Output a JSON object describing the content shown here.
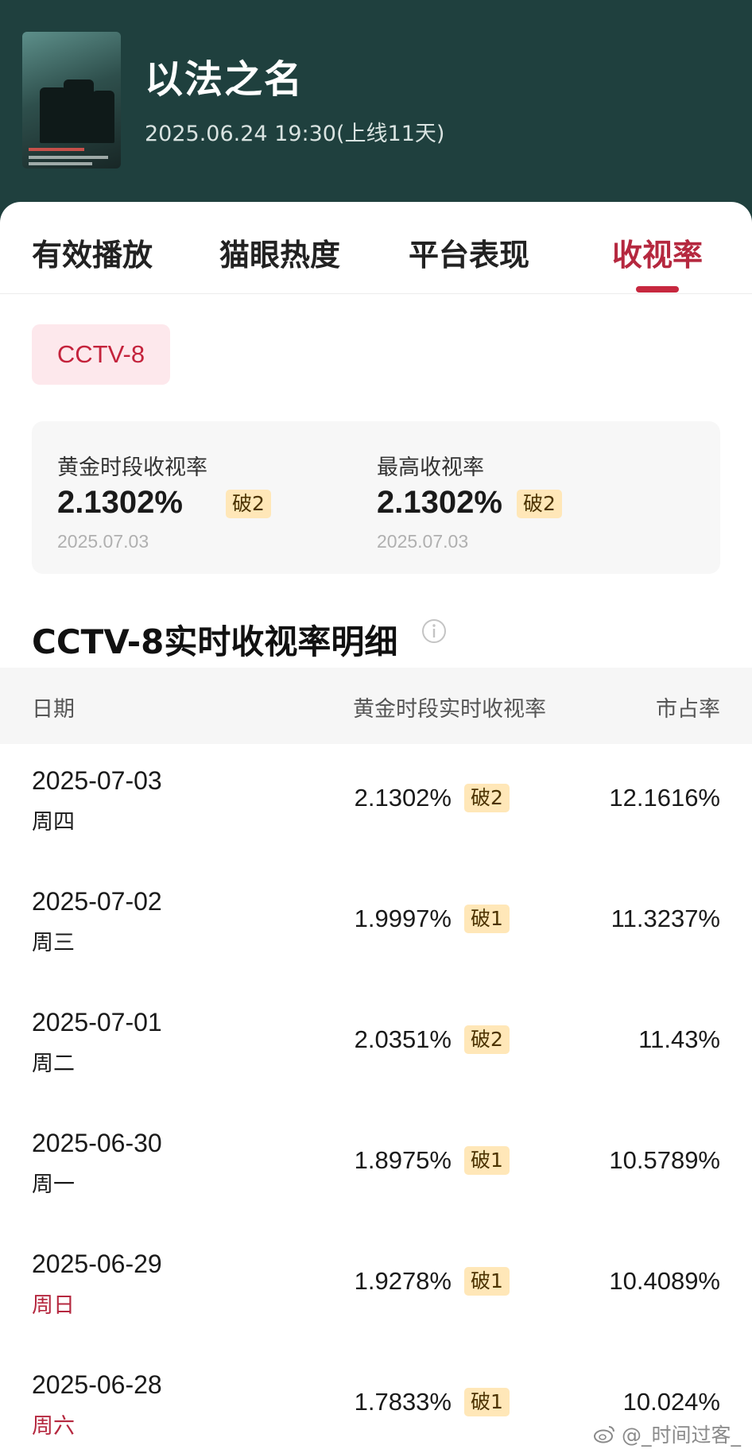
{
  "header": {
    "title": "以法之名",
    "subtitle": "2025.06.24 19:30(上线11天)"
  },
  "tabs": [
    {
      "label": "有效播放"
    },
    {
      "label": "猫眼热度"
    },
    {
      "label": "平台表现"
    },
    {
      "label": "收视率"
    }
  ],
  "active_tab_index": 3,
  "channel_chip": "CCTV-8",
  "stats": {
    "prime": {
      "label": "黄金时段收视率",
      "value": "2.1302%",
      "badge": "破2",
      "date": "2025.07.03"
    },
    "peak": {
      "label": "最高收视率",
      "value": "2.1302%",
      "badge": "破2",
      "date": "2025.07.03"
    }
  },
  "section_title": "CCTV-8实时收视率明细",
  "table": {
    "headers": {
      "date": "日期",
      "rating": "黄金时段实时收视率",
      "share": "市占率"
    },
    "rows": [
      {
        "date": "2025-07-03",
        "weekday": "周四",
        "weekend": false,
        "rating": "2.1302%",
        "badge": "破2",
        "share": "12.1616%"
      },
      {
        "date": "2025-07-02",
        "weekday": "周三",
        "weekend": false,
        "rating": "1.9997%",
        "badge": "破1",
        "share": "11.3237%"
      },
      {
        "date": "2025-07-01",
        "weekday": "周二",
        "weekend": false,
        "rating": "2.0351%",
        "badge": "破2",
        "share": "11.43%"
      },
      {
        "date": "2025-06-30",
        "weekday": "周一",
        "weekend": false,
        "rating": "1.8975%",
        "badge": "破1",
        "share": "10.5789%"
      },
      {
        "date": "2025-06-29",
        "weekday": "周日",
        "weekend": true,
        "rating": "1.9278%",
        "badge": "破1",
        "share": "10.4089%"
      },
      {
        "date": "2025-06-28",
        "weekday": "周六",
        "weekend": true,
        "rating": "1.7833%",
        "badge": "破1",
        "share": "10.024%"
      }
    ]
  },
  "watermark": "@_时间过客_",
  "colors": {
    "header_bg": "#1f403e",
    "accent": "#c7283f",
    "badge_bg": "#ffe7b8",
    "chip_bg": "#fde8ec"
  }
}
